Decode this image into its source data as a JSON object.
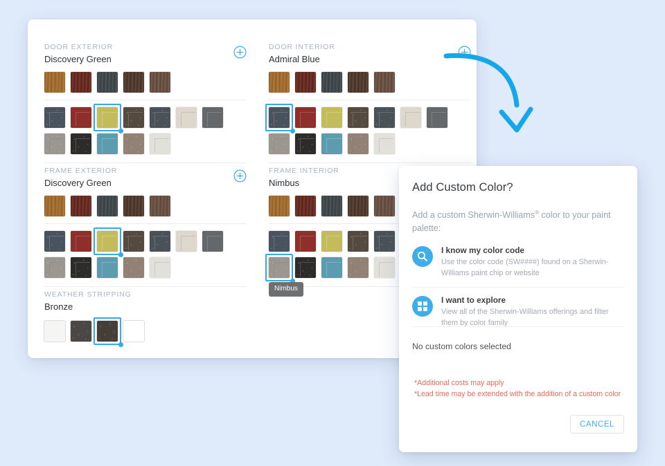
{
  "theme": {
    "background": "#dfeafa",
    "accent": "#3fadea",
    "selection_ring": "#36a9e8",
    "warning_text": "#ea6a5c",
    "card_bg": "#ffffff"
  },
  "palette": {
    "wood": [
      {
        "name": "golden-oak",
        "hex": "#a9702f"
      },
      {
        "name": "dark-cherry",
        "hex": "#6a2a20"
      },
      {
        "name": "slate-wood",
        "hex": "#41494d"
      },
      {
        "name": "espresso-wood",
        "hex": "#523a2d"
      },
      {
        "name": "walnut",
        "hex": "#6d5244"
      }
    ],
    "paint_row1": [
      {
        "name": "charcoal-blue",
        "hex": "#49535d"
      },
      {
        "name": "brick-red",
        "hex": "#8e2f2c"
      },
      {
        "name": "discovery-green",
        "hex": "#c3bc5c"
      },
      {
        "name": "dark-bronze",
        "hex": "#544a40"
      },
      {
        "name": "gunmetal",
        "hex": "#4a5257"
      },
      {
        "name": "cream",
        "hex": "#ddd7cc"
      },
      {
        "name": "stone-gray",
        "hex": "#65686a"
      }
    ],
    "paint_row2": [
      {
        "name": "nimbus",
        "hex": "#9b9690"
      },
      {
        "name": "black",
        "hex": "#2e2c2b"
      },
      {
        "name": "admiral-teal",
        "hex": "#5d9cae"
      },
      {
        "name": "taupe",
        "hex": "#918275"
      },
      {
        "name": "white-dove",
        "hex": "#e2e0da"
      }
    ],
    "weather_stripping": [
      {
        "name": "white",
        "hex": "#f5f5f4"
      },
      {
        "name": "dark-gray",
        "hex": "#4a4744"
      },
      {
        "name": "bronze",
        "hex": "#453f38"
      },
      {
        "name": "pure-white",
        "hex": "#ffffff"
      }
    ]
  },
  "sections": [
    {
      "id": "door-exterior",
      "label": "DOOR EXTERIOR",
      "value": "Discovery Green",
      "add_icon": "plus-circle-icon",
      "selected_row": 1,
      "selected_index": 2
    },
    {
      "id": "door-interior",
      "label": "DOOR INTERIOR",
      "value": "Admiral Blue",
      "add_icon": "plus-circle-icon",
      "selected_row": 1,
      "selected_index": 0
    },
    {
      "id": "frame-exterior",
      "label": "FRAME EXTERIOR",
      "value": "Discovery Green",
      "add_icon": "plus-circle-icon",
      "selected_row": 1,
      "selected_index": 2
    },
    {
      "id": "frame-interior",
      "label": "FRAME INTERIOR",
      "value": "Nimbus",
      "add_icon": "plus-circle-icon",
      "selected_row": 2,
      "selected_index": 0,
      "tooltip": "Nimbus"
    },
    {
      "id": "weather-stripping",
      "label": "WEATHER STRIPPING",
      "value": "Bronze",
      "selected_index": 2
    }
  ],
  "modal": {
    "title": "Add Custom Color?",
    "subtitle_pre": "Add a custom Sherwin-Williams",
    "subtitle_sup": "®",
    "subtitle_post": " color to your paint palette:",
    "options": [
      {
        "icon": "search-icon",
        "title": "I know my color code",
        "description": "Use the color code (SW####) found on a Sherwin-Williams paint chip or website"
      },
      {
        "icon": "grid-icon",
        "title": "I want to explore",
        "description": "View all of the Sherwin-Williams offerings and filter them by color family"
      }
    ],
    "status": "No custom colors selected",
    "notes": [
      "*Additional costs may apply",
      "*Lead time may be extended with the addition of a custom color"
    ],
    "cancel_label": "CANCEL"
  },
  "annotation": {
    "arrow_icon": "curved-down-arrow-icon"
  }
}
